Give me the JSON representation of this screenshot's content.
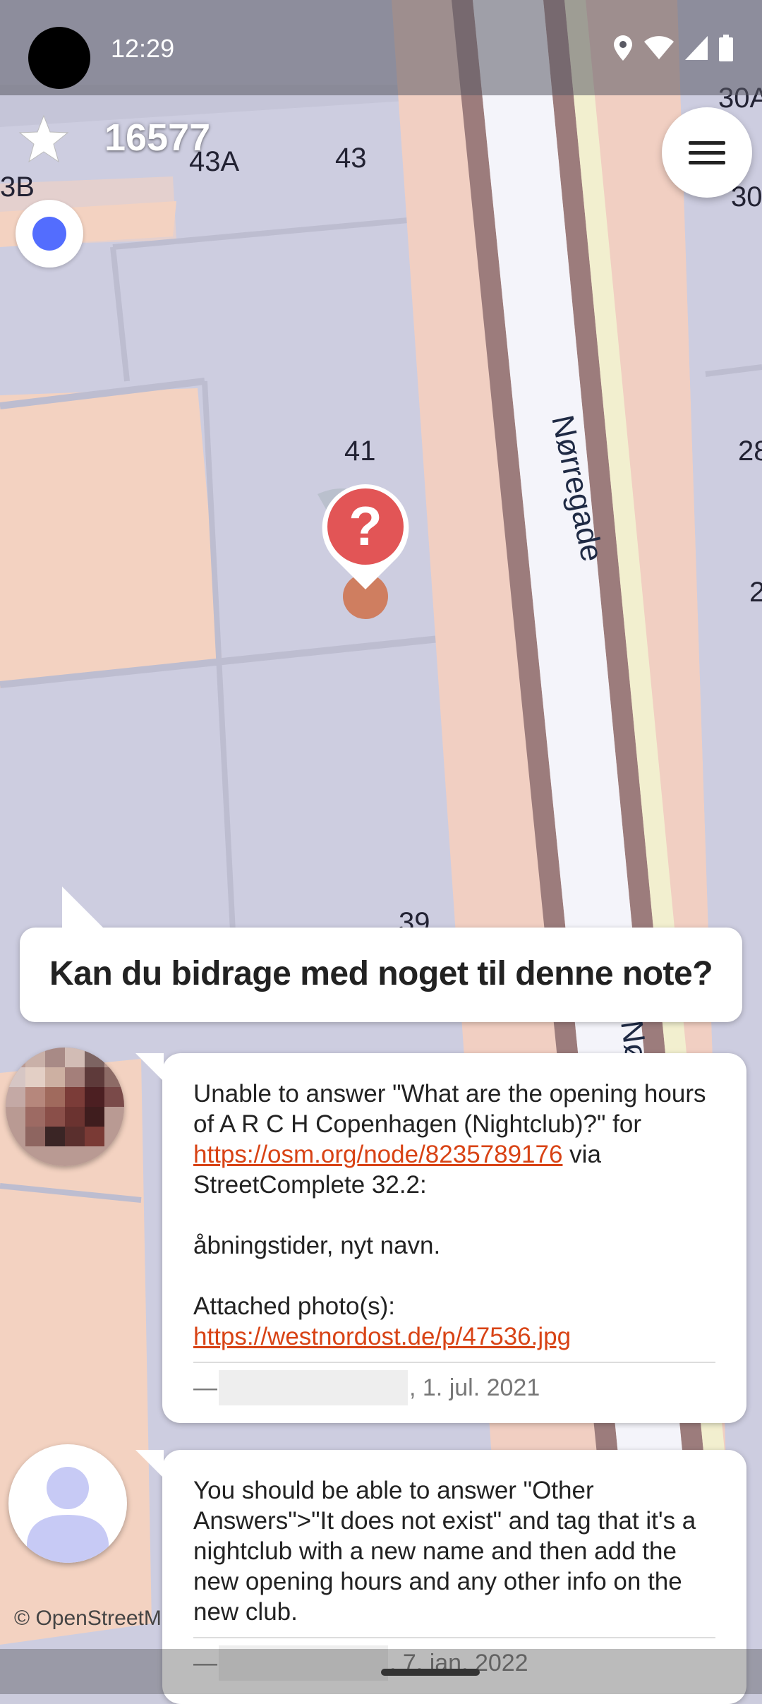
{
  "status_bar": {
    "time": "12:29",
    "icons": [
      "location-icon",
      "wifi-icon",
      "signal-icon",
      "battery-icon"
    ]
  },
  "top_bar": {
    "star_icon": "star-icon",
    "score": "16577",
    "menu_icon": "menu-icon"
  },
  "map": {
    "street_name": "Nørregade",
    "street_name_lower": "Nø",
    "house_numbers": [
      "43A",
      "43",
      "3B",
      "41",
      "39",
      "30A",
      "30",
      "28",
      "2"
    ],
    "note_marker_icon": "question-marker-icon"
  },
  "note_prompt": {
    "question": "Kan du bidrage med noget til denne note?"
  },
  "comments": [
    {
      "text_before_link": "Unable to answer \"What are the opening hours of A R C H Copenhagen (Nightclub)?\" for ",
      "link1": "https://osm.org/node/8235789176",
      "text_after_link": " via StreetComplete 32.2:\n\nåbningstider, nyt navn.\n\nAttached photo(s):\n",
      "link2": "https://westnordost.de/p/47536.jpg",
      "author_prefix": "—",
      "date": ", 1. jul. 2021"
    },
    {
      "text": "You should be able to answer \"Other Answers\">\"It does not exist\" and tag that it's a nightclub with a new name and then add the new opening hours and any other info on the new club.",
      "author_prefix": "—",
      "date": ", 7. jan. 2022"
    }
  ],
  "attribution": "© OpenStreetMap",
  "colors": {
    "map_block": "#ccccdd",
    "building": "#f3d2c1",
    "road": "#efeff6",
    "road_border": "#9c7c7c",
    "marker_red": "#e25556",
    "link": "#d84315",
    "location_dot": "#536dfe"
  }
}
